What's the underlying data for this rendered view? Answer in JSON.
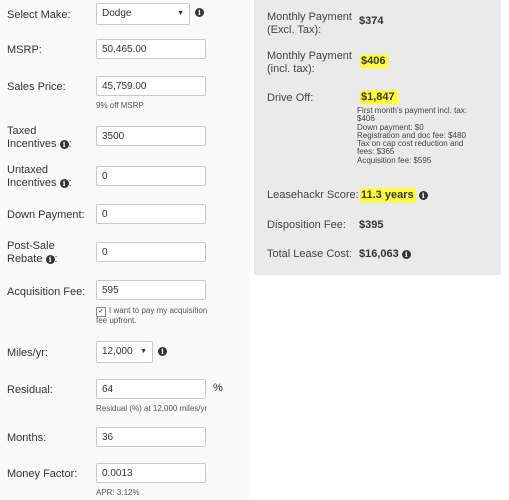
{
  "form": {
    "make": {
      "label": "Select Make:",
      "value": "Dodge"
    },
    "msrp": {
      "label": "MSRP:",
      "value": "50,465.00"
    },
    "sales_price": {
      "label": "Sales Price:",
      "value": "45,759.00",
      "note": "9% off MSRP"
    },
    "taxed_incentives": {
      "label_line1": "Taxed",
      "label_line2": "Incentives",
      "value": "3500"
    },
    "untaxed_incentives": {
      "label_line1": "Untaxed",
      "label_line2": "Incentives",
      "value": "0"
    },
    "down_payment": {
      "label": "Down Payment:",
      "value": "0"
    },
    "post_sale_rebate": {
      "label_line1": "Post-Sale",
      "label_line2": "Rebate",
      "label_suffix": ":",
      "value": "0"
    },
    "acquisition_fee": {
      "label": "Acquisition Fee:",
      "value": "595",
      "checkbox_checked": true,
      "checkbox_line1": "I want to pay my acquisition",
      "checkbox_line2": "fee upfront."
    },
    "miles": {
      "label": "Miles/yr:",
      "value": "12,000"
    },
    "residual": {
      "label": "Residual:",
      "value": "64",
      "unit": "%",
      "note": "Residual (%) at 12,000 miles/yr"
    },
    "months": {
      "label": "Months:",
      "value": "36"
    },
    "money_factor": {
      "label": "Money Factor:",
      "value": "0.0013",
      "note": "APR: 3.12%"
    }
  },
  "icons": {
    "info": "info-circle-icon",
    "dropdown": "caret-down-icon",
    "checkmark": "checkmark-icon",
    "info_glyph": "i",
    "caret_glyph": "▼",
    "check_glyph": "✓"
  },
  "results": {
    "monthly_excl": {
      "label_line1": "Monthly Payment",
      "label_line2": "(Excl. Tax):",
      "value": "$374"
    },
    "monthly_incl": {
      "label_line1": "Monthly Payment",
      "label_line2": "(incl. tax):",
      "value": "$406"
    },
    "drive_off": {
      "label": "Drive Off:",
      "value": "$1,847",
      "breakdown": [
        "First month's payment incl. tax:",
        "$406",
        "Down payment: $0",
        "Registration and doc fee: $480",
        "Tax on cap cost reduction and",
        "fees: $365",
        "Acquisition fee: $595"
      ]
    },
    "score": {
      "label": "Leasehackr Score:",
      "value": "11.3 years"
    },
    "disposition": {
      "label": "Disposition Fee:",
      "value": "$395"
    },
    "total": {
      "label": "Total Lease Cost:",
      "value": "$16,063"
    }
  },
  "colors": {
    "highlight": "#ffff33",
    "panel": "#eaeaea",
    "left_bg": "#f9f9f9"
  }
}
